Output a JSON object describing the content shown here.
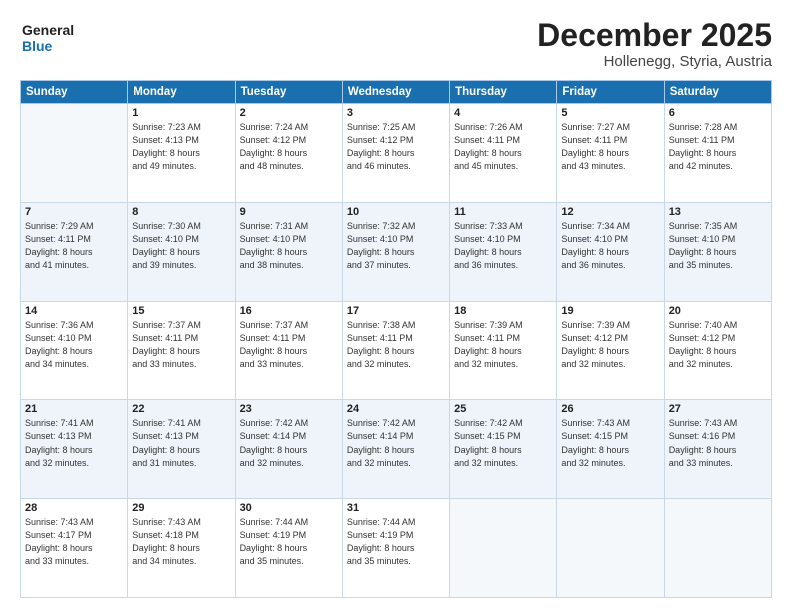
{
  "header": {
    "logo_line1": "General",
    "logo_line2": "Blue",
    "month": "December 2025",
    "location": "Hollenegg, Styria, Austria"
  },
  "weekdays": [
    "Sunday",
    "Monday",
    "Tuesday",
    "Wednesday",
    "Thursday",
    "Friday",
    "Saturday"
  ],
  "weeks": [
    [
      {
        "day": "",
        "info": ""
      },
      {
        "day": "1",
        "info": "Sunrise: 7:23 AM\nSunset: 4:13 PM\nDaylight: 8 hours\nand 49 minutes."
      },
      {
        "day": "2",
        "info": "Sunrise: 7:24 AM\nSunset: 4:12 PM\nDaylight: 8 hours\nand 48 minutes."
      },
      {
        "day": "3",
        "info": "Sunrise: 7:25 AM\nSunset: 4:12 PM\nDaylight: 8 hours\nand 46 minutes."
      },
      {
        "day": "4",
        "info": "Sunrise: 7:26 AM\nSunset: 4:11 PM\nDaylight: 8 hours\nand 45 minutes."
      },
      {
        "day": "5",
        "info": "Sunrise: 7:27 AM\nSunset: 4:11 PM\nDaylight: 8 hours\nand 43 minutes."
      },
      {
        "day": "6",
        "info": "Sunrise: 7:28 AM\nSunset: 4:11 PM\nDaylight: 8 hours\nand 42 minutes."
      }
    ],
    [
      {
        "day": "7",
        "info": "Sunrise: 7:29 AM\nSunset: 4:11 PM\nDaylight: 8 hours\nand 41 minutes."
      },
      {
        "day": "8",
        "info": "Sunrise: 7:30 AM\nSunset: 4:10 PM\nDaylight: 8 hours\nand 39 minutes."
      },
      {
        "day": "9",
        "info": "Sunrise: 7:31 AM\nSunset: 4:10 PM\nDaylight: 8 hours\nand 38 minutes."
      },
      {
        "day": "10",
        "info": "Sunrise: 7:32 AM\nSunset: 4:10 PM\nDaylight: 8 hours\nand 37 minutes."
      },
      {
        "day": "11",
        "info": "Sunrise: 7:33 AM\nSunset: 4:10 PM\nDaylight: 8 hours\nand 36 minutes."
      },
      {
        "day": "12",
        "info": "Sunrise: 7:34 AM\nSunset: 4:10 PM\nDaylight: 8 hours\nand 36 minutes."
      },
      {
        "day": "13",
        "info": "Sunrise: 7:35 AM\nSunset: 4:10 PM\nDaylight: 8 hours\nand 35 minutes."
      }
    ],
    [
      {
        "day": "14",
        "info": "Sunrise: 7:36 AM\nSunset: 4:10 PM\nDaylight: 8 hours\nand 34 minutes."
      },
      {
        "day": "15",
        "info": "Sunrise: 7:37 AM\nSunset: 4:11 PM\nDaylight: 8 hours\nand 33 minutes."
      },
      {
        "day": "16",
        "info": "Sunrise: 7:37 AM\nSunset: 4:11 PM\nDaylight: 8 hours\nand 33 minutes."
      },
      {
        "day": "17",
        "info": "Sunrise: 7:38 AM\nSunset: 4:11 PM\nDaylight: 8 hours\nand 32 minutes."
      },
      {
        "day": "18",
        "info": "Sunrise: 7:39 AM\nSunset: 4:11 PM\nDaylight: 8 hours\nand 32 minutes."
      },
      {
        "day": "19",
        "info": "Sunrise: 7:39 AM\nSunset: 4:12 PM\nDaylight: 8 hours\nand 32 minutes."
      },
      {
        "day": "20",
        "info": "Sunrise: 7:40 AM\nSunset: 4:12 PM\nDaylight: 8 hours\nand 32 minutes."
      }
    ],
    [
      {
        "day": "21",
        "info": "Sunrise: 7:41 AM\nSunset: 4:13 PM\nDaylight: 8 hours\nand 32 minutes."
      },
      {
        "day": "22",
        "info": "Sunrise: 7:41 AM\nSunset: 4:13 PM\nDaylight: 8 hours\nand 31 minutes."
      },
      {
        "day": "23",
        "info": "Sunrise: 7:42 AM\nSunset: 4:14 PM\nDaylight: 8 hours\nand 32 minutes."
      },
      {
        "day": "24",
        "info": "Sunrise: 7:42 AM\nSunset: 4:14 PM\nDaylight: 8 hours\nand 32 minutes."
      },
      {
        "day": "25",
        "info": "Sunrise: 7:42 AM\nSunset: 4:15 PM\nDaylight: 8 hours\nand 32 minutes."
      },
      {
        "day": "26",
        "info": "Sunrise: 7:43 AM\nSunset: 4:15 PM\nDaylight: 8 hours\nand 32 minutes."
      },
      {
        "day": "27",
        "info": "Sunrise: 7:43 AM\nSunset: 4:16 PM\nDaylight: 8 hours\nand 33 minutes."
      }
    ],
    [
      {
        "day": "28",
        "info": "Sunrise: 7:43 AM\nSunset: 4:17 PM\nDaylight: 8 hours\nand 33 minutes."
      },
      {
        "day": "29",
        "info": "Sunrise: 7:43 AM\nSunset: 4:18 PM\nDaylight: 8 hours\nand 34 minutes."
      },
      {
        "day": "30",
        "info": "Sunrise: 7:44 AM\nSunset: 4:19 PM\nDaylight: 8 hours\nand 35 minutes."
      },
      {
        "day": "31",
        "info": "Sunrise: 7:44 AM\nSunset: 4:19 PM\nDaylight: 8 hours\nand 35 minutes."
      },
      {
        "day": "",
        "info": ""
      },
      {
        "day": "",
        "info": ""
      },
      {
        "day": "",
        "info": ""
      }
    ]
  ]
}
